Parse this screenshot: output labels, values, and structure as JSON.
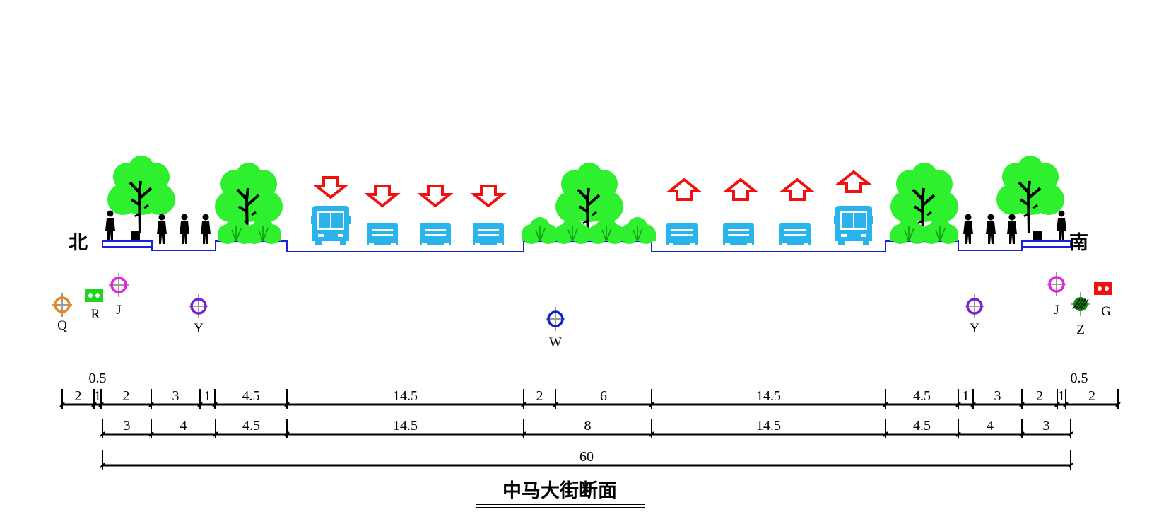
{
  "directions": {
    "north": "北",
    "south": "南"
  },
  "title": "中马大街断面",
  "pipelines": [
    {
      "code": "Q",
      "color": "#f0841c",
      "type": "circle-icon"
    },
    {
      "code": "R",
      "color": "#1fd31f",
      "type": "box-icon"
    },
    {
      "code": "J",
      "color": "#e61ee6",
      "type": "circle-icon"
    },
    {
      "code": "Y",
      "color": "#7a1fd6",
      "type": "circle-icon"
    },
    {
      "code": "W",
      "color": "#1422c8",
      "type": "circle-icon"
    },
    {
      "code": "Y",
      "color": "#7a1fd6",
      "type": "circle-icon"
    },
    {
      "code": "J",
      "color": "#e61ee6",
      "type": "circle-icon"
    },
    {
      "code": "Z",
      "color": "#0e8a0e",
      "type": "hatched-icon"
    },
    {
      "code": "G",
      "color": "#f01010",
      "type": "box-icon"
    }
  ],
  "dimensions": {
    "row1": [
      "2",
      "1",
      "2",
      "3",
      "1",
      "4.5",
      "14.5",
      "2",
      "6",
      "14.5",
      "4.5",
      "1",
      "3",
      "2",
      "1",
      "2"
    ],
    "row1_extra": [
      "0.5",
      "0.5"
    ],
    "row2": [
      "3",
      "4",
      "4.5",
      "14.5",
      "8",
      "14.5",
      "4.5",
      "4",
      "3"
    ],
    "row3": [
      "60"
    ]
  },
  "colors": {
    "tree": "#2ef02e",
    "vehicle": "#2ab4ec",
    "arrow": "#f01010",
    "road_outline": "#1a22d8"
  },
  "icons": [
    "tree-icon",
    "shrub-icon",
    "pedestrian-icon",
    "bus-icon",
    "car-icon",
    "arrow-down-icon",
    "arrow-up-icon"
  ]
}
